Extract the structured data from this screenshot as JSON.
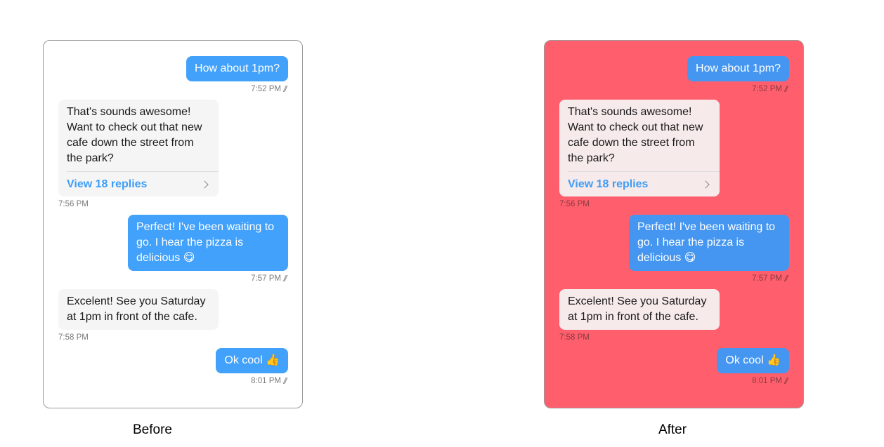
{
  "panels": [
    {
      "id": "before",
      "label": "Before",
      "colors": {
        "background": "#ffffff",
        "sent_bubble": "#42a1fb",
        "received_bubble": "#f5f5f5",
        "timestamp": "#7a7a7a",
        "link": "#3d9df8"
      }
    },
    {
      "id": "after",
      "label": "After",
      "colors": {
        "background": "#ff5f6d",
        "sent_bubble": "#4596f0",
        "received_bubble": "#f6eaea",
        "timestamp": "#8a3a42",
        "link": "#3d9df8"
      }
    }
  ],
  "messages": [
    {
      "direction": "sent",
      "text": "How about 1pm?",
      "time": "7:52 PM",
      "read_icon": "double-check-icon"
    },
    {
      "direction": "received",
      "text": "That's sounds awesome! Want to check out that new cafe down the street from the park?",
      "time": "7:56 PM",
      "thread_link": "View 18 replies"
    },
    {
      "direction": "sent",
      "text": "Perfect! I've been waiting to go. I hear the pizza is delicious 😋",
      "time": "7:57 PM",
      "read_icon": "double-check-icon"
    },
    {
      "direction": "received",
      "text": "Excelent! See you Saturday at 1pm in front of the cafe.",
      "time": "7:58 PM"
    },
    {
      "direction": "sent",
      "text": "Ok cool 👍",
      "time": "8:01 PM",
      "read_icon": "double-check-icon"
    }
  ]
}
